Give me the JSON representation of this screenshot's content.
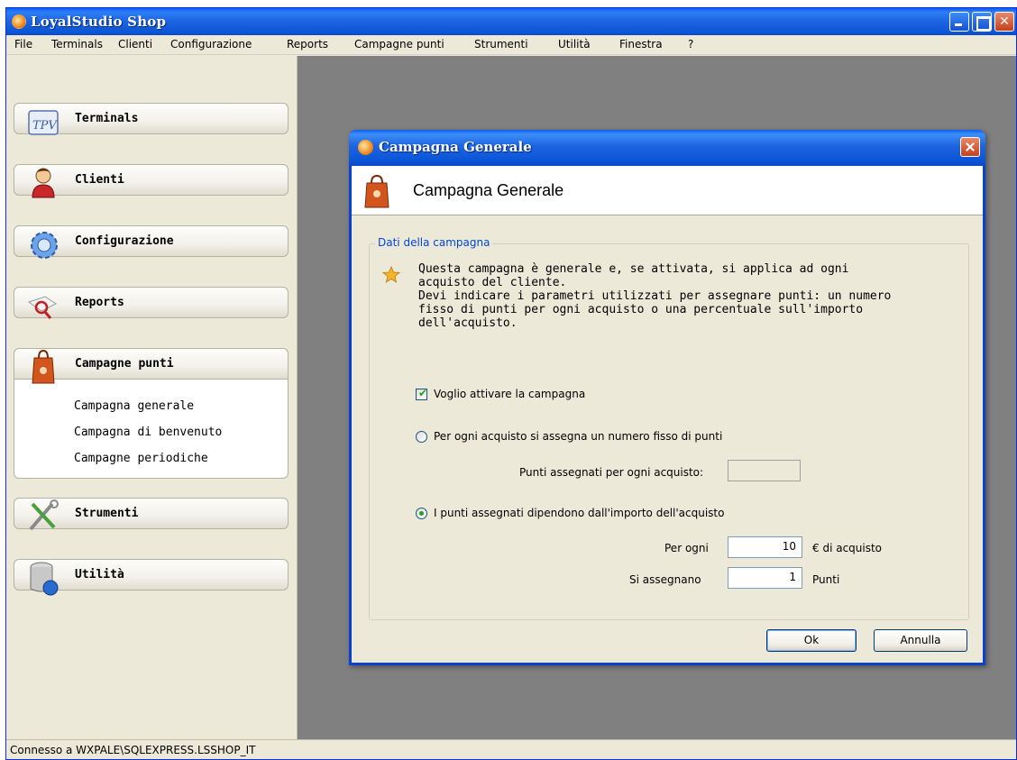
{
  "window": {
    "title": "LoyalStudio Shop"
  },
  "menu": [
    "File",
    "Terminals",
    "Clienti",
    "Configurazione",
    "Reports",
    "Campagne punti",
    "Strumenti",
    "Utilità",
    "Finestra",
    "?"
  ],
  "sidebar": {
    "groups": [
      {
        "label": "Terminals",
        "icon": "tpv-icon"
      },
      {
        "label": "Clienti",
        "icon": "user-icon"
      },
      {
        "label": "Configurazione",
        "icon": "gear-icon"
      },
      {
        "label": "Reports",
        "icon": "magnifier-icon"
      },
      {
        "label": "Campagne punti",
        "icon": "shopping-bag-icon",
        "items": [
          "Campagna generale",
          "Campagna di benvenuto",
          "Campagne periodiche"
        ]
      },
      {
        "label": "Strumenti",
        "icon": "tools-icon"
      },
      {
        "label": "Utilità",
        "icon": "database-icon"
      }
    ]
  },
  "status": {
    "text": "Connesso a WXPALE\\SQLEXPRESS.LSSHOP_IT"
  },
  "dialog": {
    "title": "Campagna Generale",
    "header": "Campagna Generale",
    "group_title": "Dati della campagna",
    "info": "Questa campagna è generale e, se attivata, si applica ad ogni\nacquisto del cliente.\nDevi indicare i parametri utilizzati per assegnare punti: un numero\nfisso di punti per ogni acquisto o una percentuale sull'importo\ndell'acquisto.",
    "activate_label": "Voglio attivare la campagna",
    "activate_checked": true,
    "option_fixed_label": "Per ogni acquisto si assegna un numero fisso di punti",
    "fixed_points_label": "Punti assegnati per ogni acquisto:",
    "fixed_points_value": "",
    "option_amount_label": "I punti assegnati dipendono dall'importo dell'acquisto",
    "selected_option": "amount",
    "per_ogni_label": "Per ogni",
    "per_ogni_value": "10",
    "per_ogni_unit": "€ di acquisto",
    "si_assegnano_label": "Si assegnano",
    "si_assegnano_value": "1",
    "si_assegnano_unit": "Punti",
    "ok_label": "Ok",
    "cancel_label": "Annulla"
  }
}
